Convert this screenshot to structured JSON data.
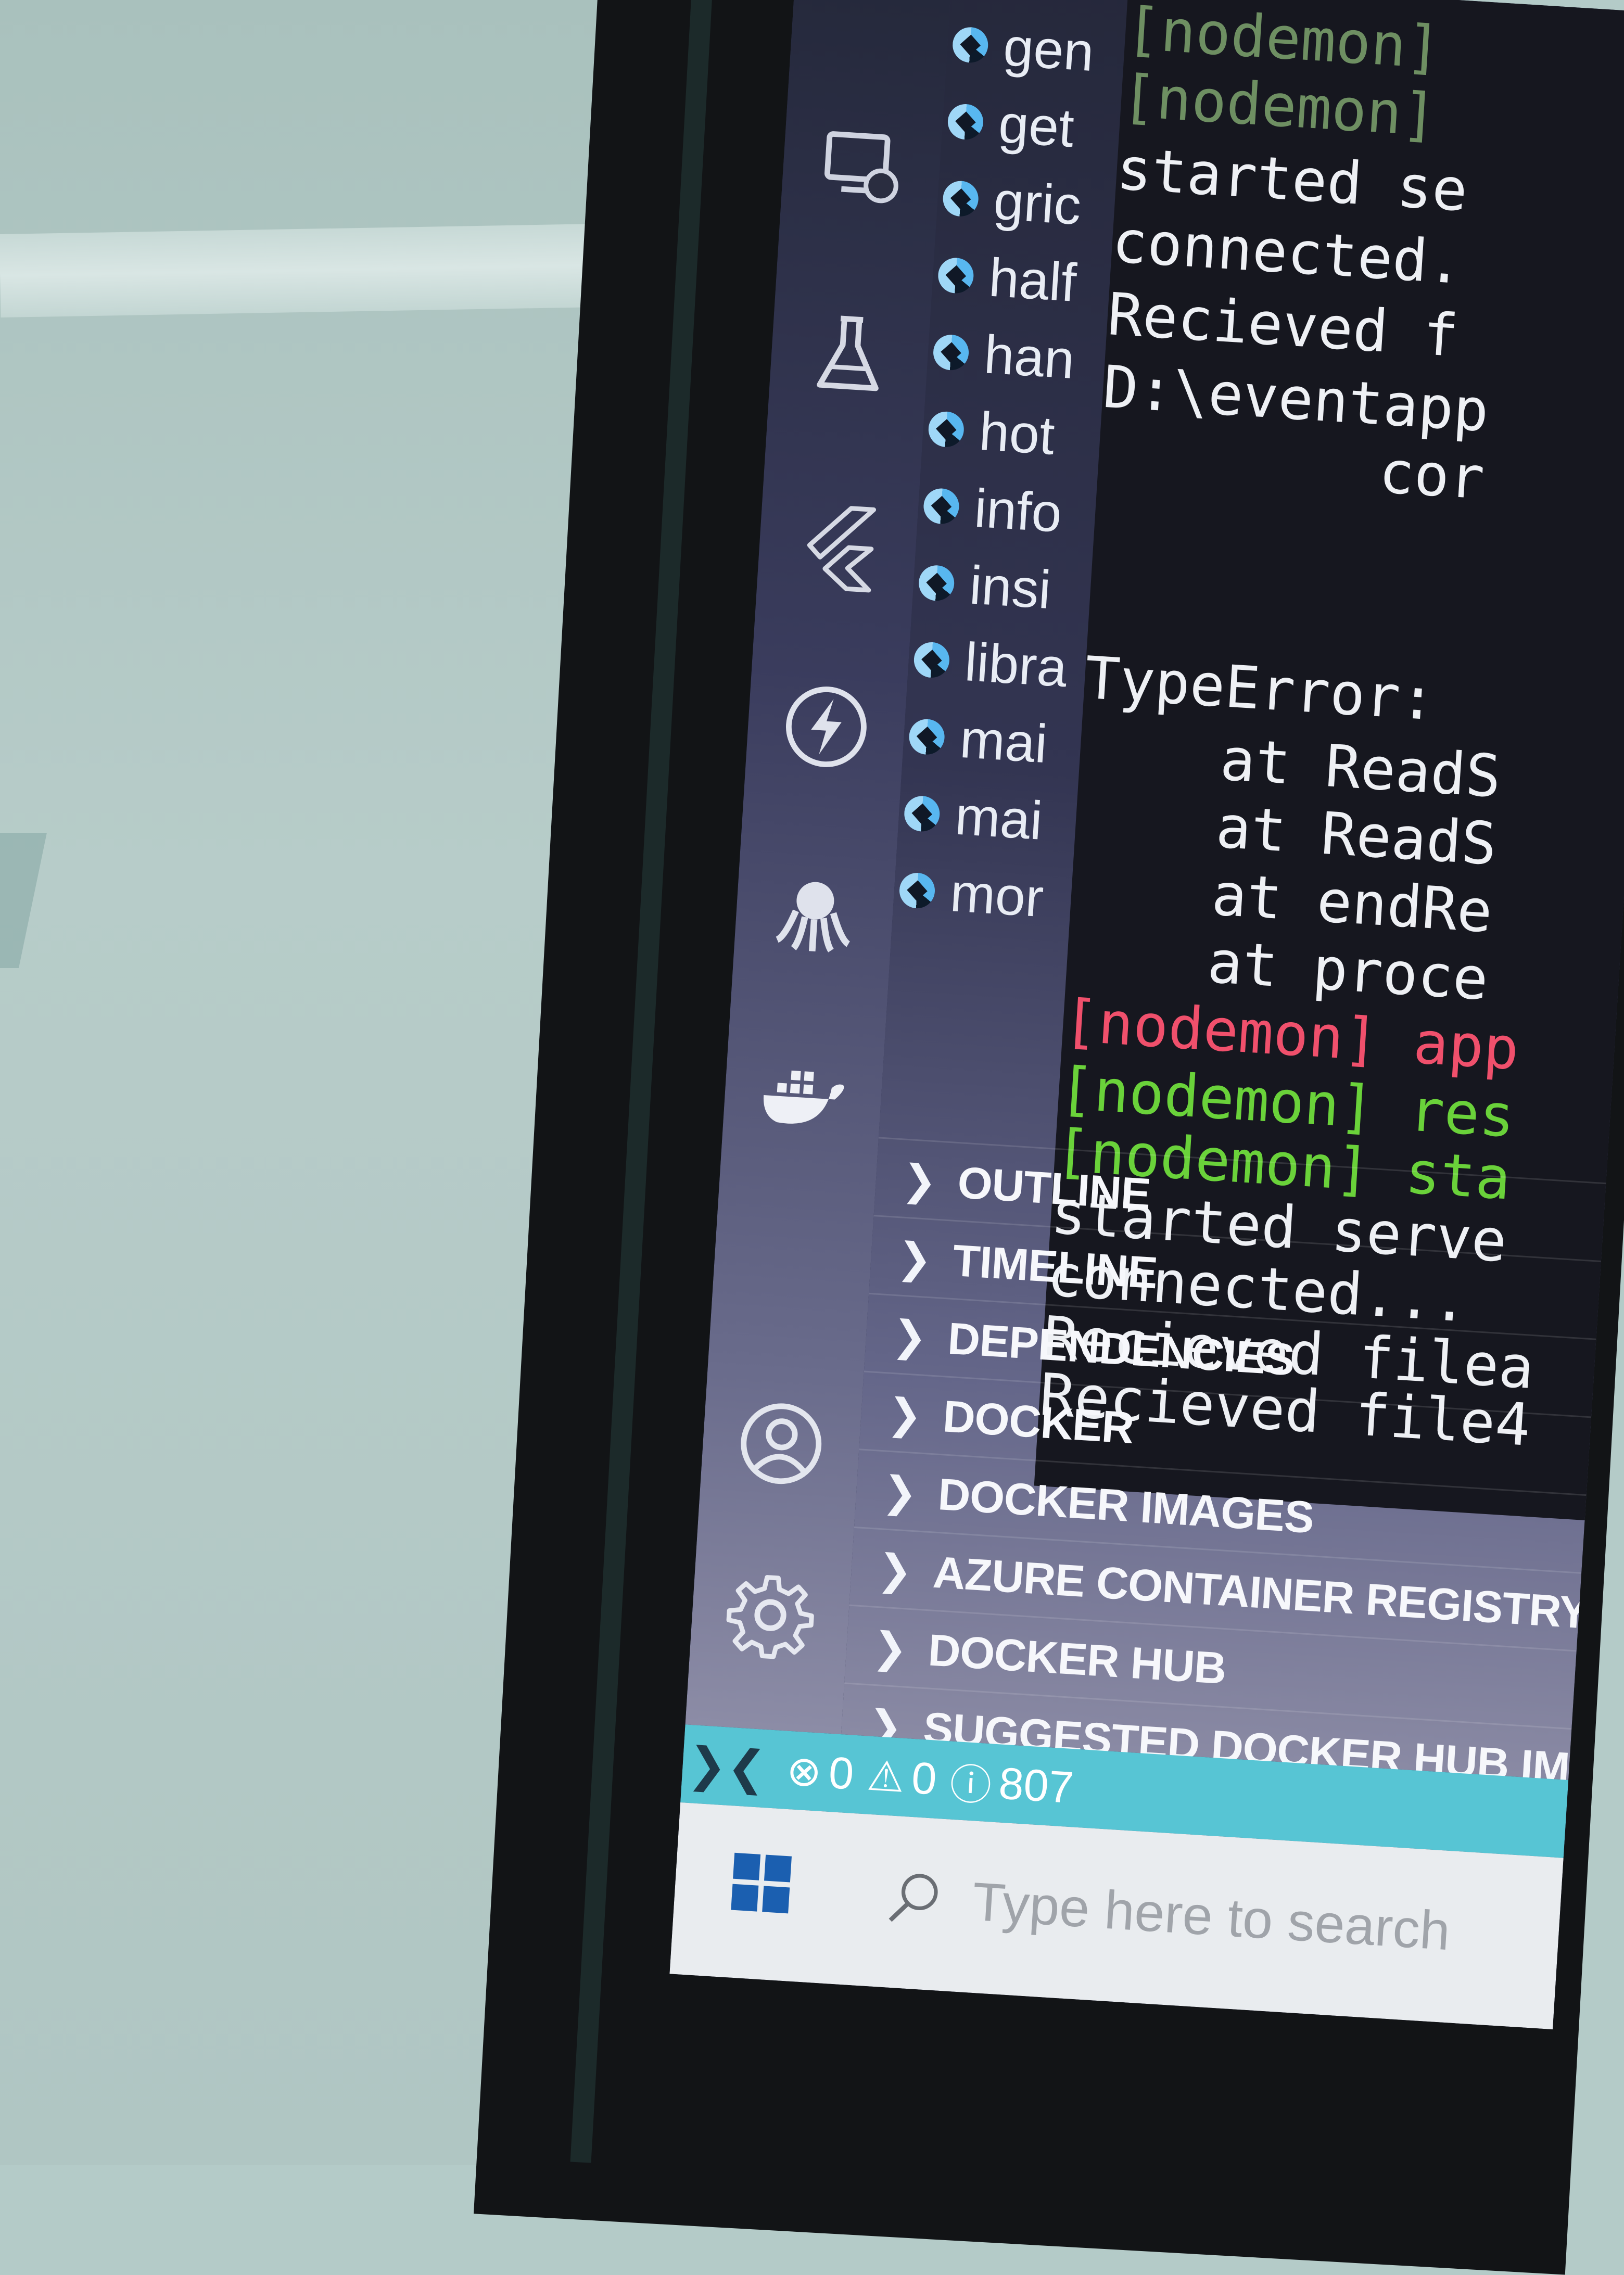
{
  "activity_bar": {
    "icons": [
      "remote-explorer-icon",
      "testing-flask-icon",
      "flutter-icon",
      "thunder-client-icon",
      "octopus-icon",
      "docker-whale-icon",
      "account-icon",
      "settings-gear-icon"
    ]
  },
  "explorer": {
    "files": [
      {
        "label": "gen"
      },
      {
        "label": "get"
      },
      {
        "label": "gric"
      },
      {
        "label": "half"
      },
      {
        "label": "han"
      },
      {
        "label": "hot"
      },
      {
        "label": "info"
      },
      {
        "label": "insi"
      },
      {
        "label": "libra"
      },
      {
        "label": "mai"
      },
      {
        "label": "mai"
      },
      {
        "label": "mor"
      }
    ],
    "sections": [
      {
        "label": "OUTLINE"
      },
      {
        "label": "TIMELINE"
      },
      {
        "label": "DEPENDENCIES"
      },
      {
        "label": "DOCKER"
      },
      {
        "label": "DOCKER IMAGES"
      },
      {
        "label": "AZURE CONTAINER REGISTRY"
      },
      {
        "label": "DOCKER HUB"
      },
      {
        "label": "SUGGESTED DOCKER HUB IMAGES"
      }
    ]
  },
  "terminal": {
    "lines": [
      {
        "text": "[nodemon]",
        "style": "dim"
      },
      {
        "text": "[nodemon]",
        "style": "dim"
      },
      {
        "text": "started se",
        "style": "normal"
      },
      {
        "text": "connected.",
        "style": "normal"
      },
      {
        "text": "Recieved f",
        "style": "normal"
      },
      {
        "text": "D:\\eventapp",
        "style": "normal"
      },
      {
        "text": "        cor",
        "style": "normal"
      },
      {
        "text": "",
        "style": "normal"
      },
      {
        "text": "TypeError:",
        "style": "normal"
      },
      {
        "text": "    at ReadS",
        "style": "normal"
      },
      {
        "text": "    at ReadS",
        "style": "normal"
      },
      {
        "text": "    at endRe",
        "style": "normal"
      },
      {
        "text": "    at proce",
        "style": "normal"
      },
      {
        "text": "[nodemon] app",
        "style": "red"
      },
      {
        "text": "[nodemon] res",
        "style": "green"
      },
      {
        "text": "[nodemon] sta",
        "style": "green"
      },
      {
        "text": "started serve",
        "style": "normal"
      },
      {
        "text": "connected...",
        "style": "normal"
      },
      {
        "text": "Recieved filea",
        "style": "normal"
      },
      {
        "text": "Recieved file4",
        "style": "normal"
      }
    ]
  },
  "status_bar": {
    "errors": "0",
    "warnings": "0",
    "info": "807",
    "background": "#57c5d4"
  },
  "taskbar": {
    "search_placeholder": "Type here to search"
  }
}
